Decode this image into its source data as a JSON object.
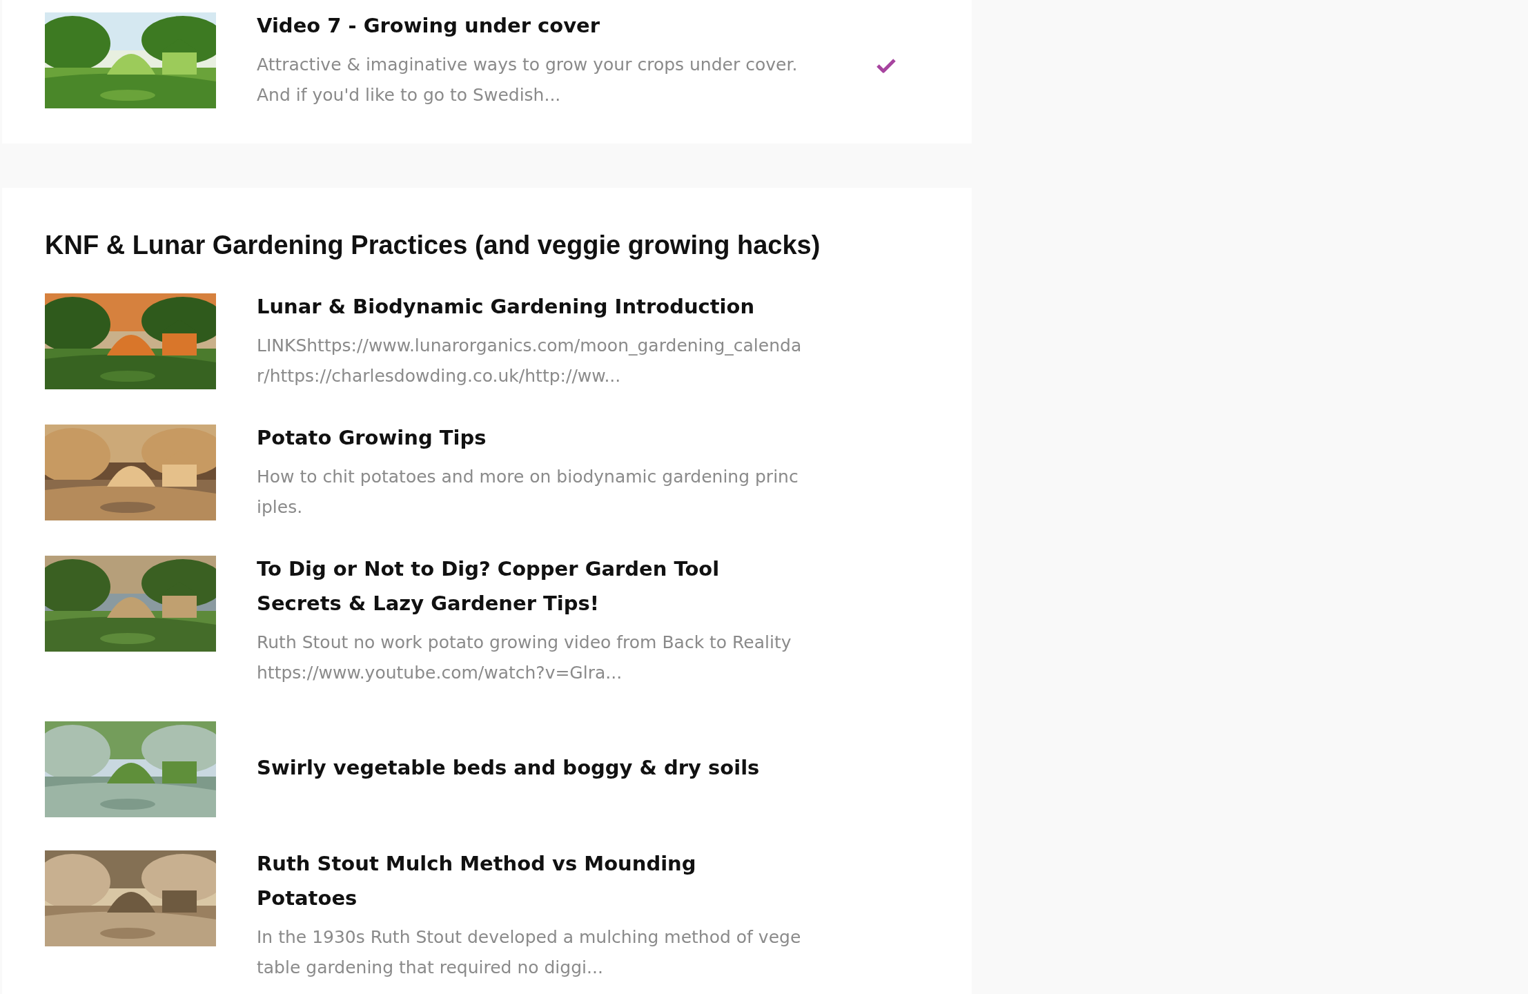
{
  "sections": [
    {
      "lessons": [
        {
          "title": "Video 7 - Growing under cover",
          "description": "Attractive & imaginative ways to grow your crops under cover. And if you'd like to go to Swedish...",
          "completed": true
        }
      ]
    },
    {
      "heading": "KNF & Lunar Gardening Practices (and veggie growing hacks)",
      "lessons": [
        {
          "title": "Lunar & Biodynamic Gardening Introduction",
          "description": "LINKShttps://www.lunarorganics.com/moon_gardening_calendar/https://charlesdowding.co.uk/http://ww...",
          "completed": false
        },
        {
          "title": "Potato Growing Tips",
          "description": "How to chit potatoes and more on biodynamic gardening principles.",
          "completed": false
        },
        {
          "title": "To Dig or Not to Dig? Copper Garden Tool Secrets & Lazy Gardener Tips!",
          "description": "Ruth Stout no work potato growing video from Back to Reality https://www.youtube.com/watch?v=Glra...",
          "completed": false
        },
        {
          "title": "Swirly vegetable beds and boggy & dry soils",
          "completed": false
        },
        {
          "title": "Ruth Stout Mulch Method vs Mounding Potatoes",
          "description": "In the 1930s Ruth Stout developed a mulching method of vegetable gardening that required no diggi...",
          "completed": false
        }
      ]
    }
  ]
}
